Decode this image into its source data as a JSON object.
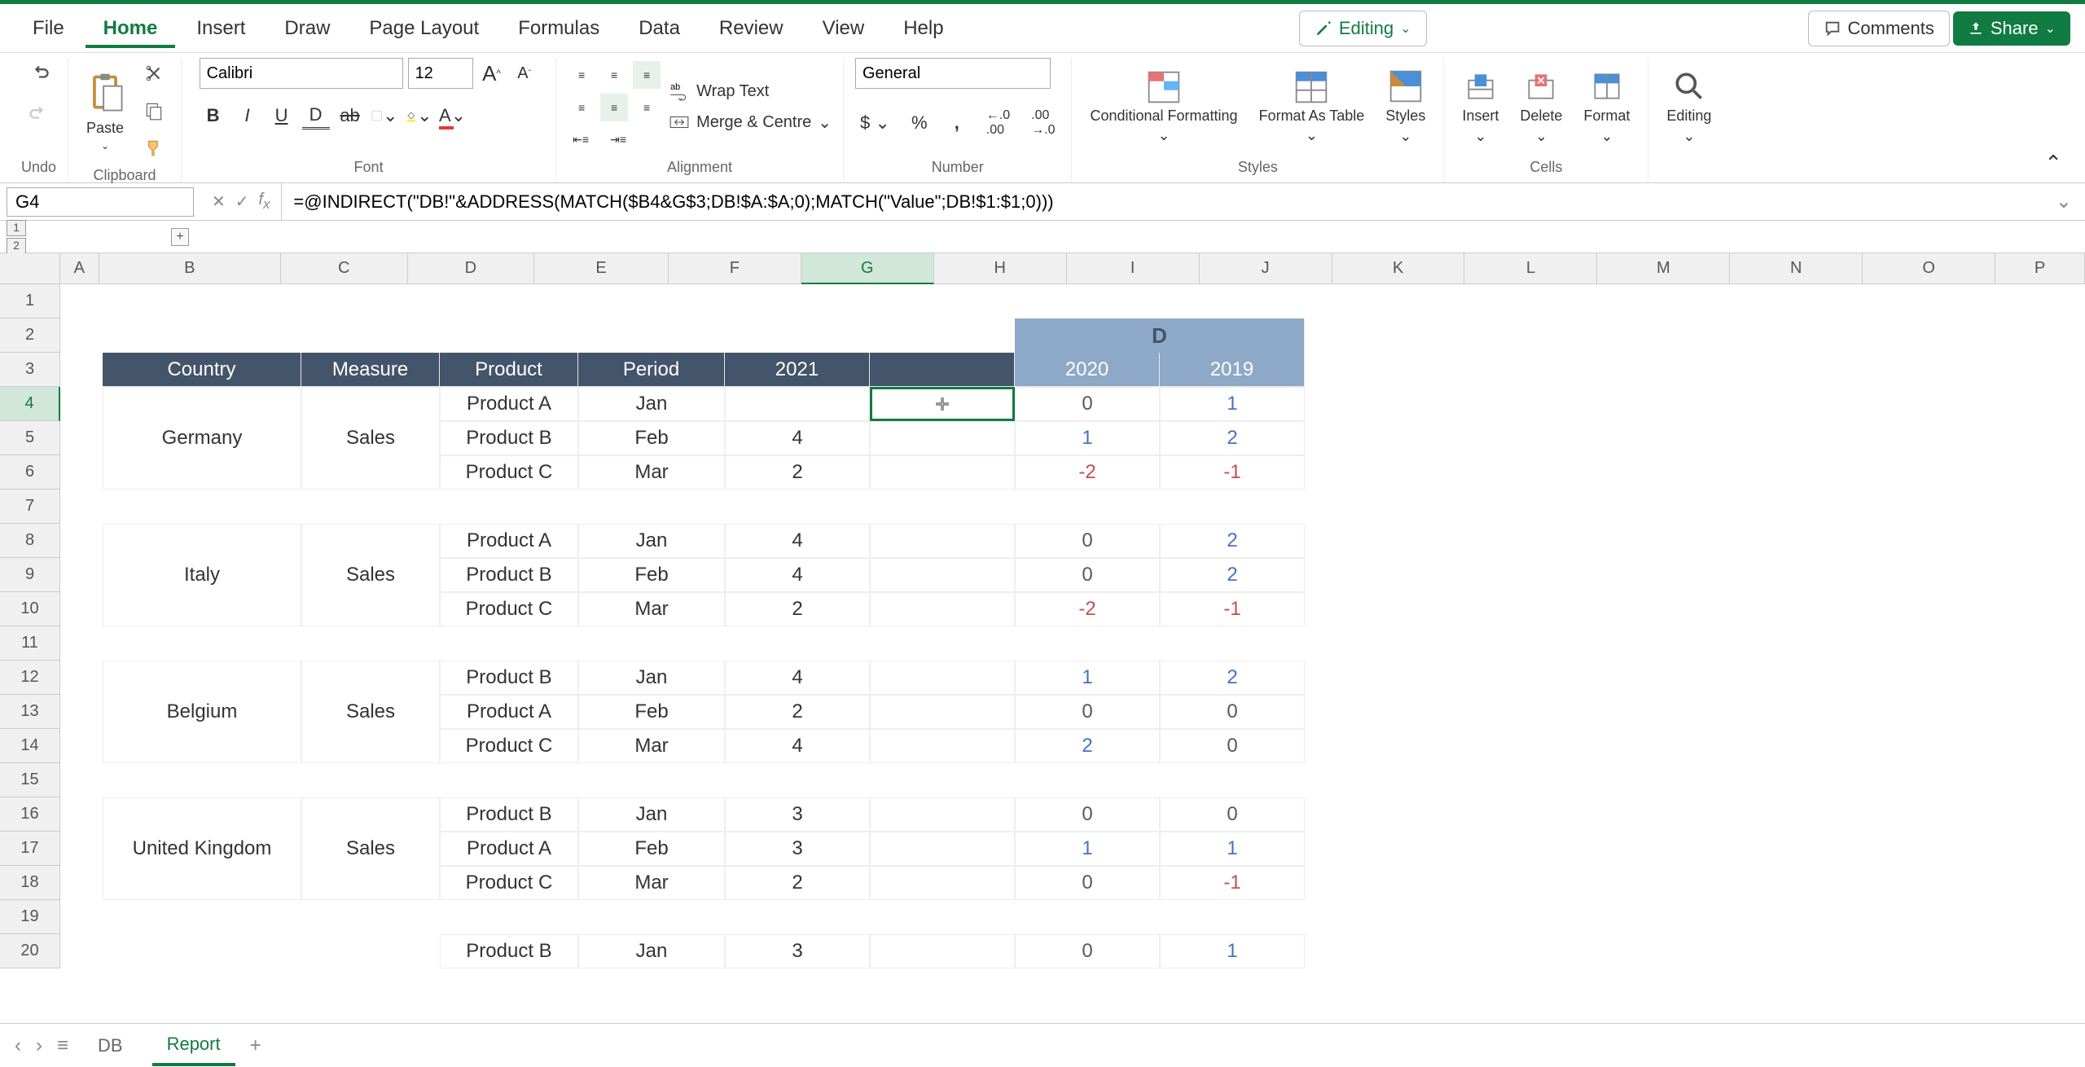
{
  "menu": {
    "file": "File",
    "home": "Home",
    "insert": "Insert",
    "draw": "Draw",
    "page_layout": "Page Layout",
    "formulas": "Formulas",
    "data": "Data",
    "review": "Review",
    "view": "View",
    "help": "Help"
  },
  "topright": {
    "editing": "Editing",
    "comments": "Comments",
    "share": "Share"
  },
  "ribbon": {
    "undo_label": "Undo",
    "clipboard": {
      "paste": "Paste",
      "label": "Clipboard"
    },
    "font": {
      "name": "Calibri",
      "size": "12",
      "label": "Font"
    },
    "alignment": {
      "wrap": "Wrap Text",
      "merge": "Merge & Centre",
      "label": "Alignment"
    },
    "number": {
      "format": "General",
      "label": "Number"
    },
    "styles": {
      "cond": "Conditional Formatting",
      "table": "Format As Table",
      "styles": "Styles",
      "label": "Styles"
    },
    "cells": {
      "insert": "Insert",
      "delete": "Delete",
      "format": "Format",
      "label": "Cells"
    },
    "editing_grp": {
      "editing": "Editing"
    }
  },
  "formula_bar": {
    "cell_ref": "G4",
    "formula": "=@INDIRECT(\"DB!\"&ADDRESS(MATCH($B4&G$3;DB!$A:$A;0);MATCH(\"Value\";DB!$1:$1;0)))"
  },
  "cols": [
    "A",
    "B",
    "C",
    "D",
    "E",
    "F",
    "G",
    "H",
    "I",
    "J",
    "K",
    "L",
    "M",
    "N",
    "O",
    "P"
  ],
  "row_count": 20,
  "table": {
    "d_label": "D",
    "headers": {
      "country": "Country",
      "measure": "Measure",
      "product": "Product",
      "period": "Period",
      "y2021": "2021",
      "y2020": "2020",
      "y2019": "2019"
    },
    "blocks": [
      {
        "country": "Germany",
        "measure": "Sales",
        "rows": [
          {
            "product": "Product A",
            "period": "Jan",
            "y2021": "",
            "y2020": "0",
            "y2019": "1"
          },
          {
            "product": "Product B",
            "period": "Feb",
            "y2021": "4",
            "y2020": "1",
            "y2019": "2"
          },
          {
            "product": "Product C",
            "period": "Mar",
            "y2021": "2",
            "y2020": "-2",
            "y2019": "-1"
          }
        ]
      },
      {
        "country": "Italy",
        "measure": "Sales",
        "rows": [
          {
            "product": "Product A",
            "period": "Jan",
            "y2021": "4",
            "y2020": "0",
            "y2019": "2"
          },
          {
            "product": "Product B",
            "period": "Feb",
            "y2021": "4",
            "y2020": "0",
            "y2019": "2"
          },
          {
            "product": "Product C",
            "period": "Mar",
            "y2021": "2",
            "y2020": "-2",
            "y2019": "-1"
          }
        ]
      },
      {
        "country": "Belgium",
        "measure": "Sales",
        "rows": [
          {
            "product": "Product B",
            "period": "Jan",
            "y2021": "4",
            "y2020": "1",
            "y2019": "2"
          },
          {
            "product": "Product A",
            "period": "Feb",
            "y2021": "2",
            "y2020": "0",
            "y2019": "0"
          },
          {
            "product": "Product C",
            "period": "Mar",
            "y2021": "4",
            "y2020": "2",
            "y2019": "0"
          }
        ]
      },
      {
        "country": "United Kingdom",
        "measure": "Sales",
        "rows": [
          {
            "product": "Product B",
            "period": "Jan",
            "y2021": "3",
            "y2020": "0",
            "y2019": "0"
          },
          {
            "product": "Product A",
            "period": "Feb",
            "y2021": "3",
            "y2020": "1",
            "y2019": "1"
          },
          {
            "product": "Product C",
            "period": "Mar",
            "y2021": "2",
            "y2020": "0",
            "y2019": "-1"
          }
        ]
      },
      {
        "country": "",
        "measure": "",
        "rows": [
          {
            "product": "Product B",
            "period": "Jan",
            "y2021": "3",
            "y2020": "0",
            "y2019": "1"
          }
        ]
      }
    ]
  },
  "tabs": {
    "db": "DB",
    "report": "Report"
  },
  "active_col": "G",
  "active_row": 4
}
